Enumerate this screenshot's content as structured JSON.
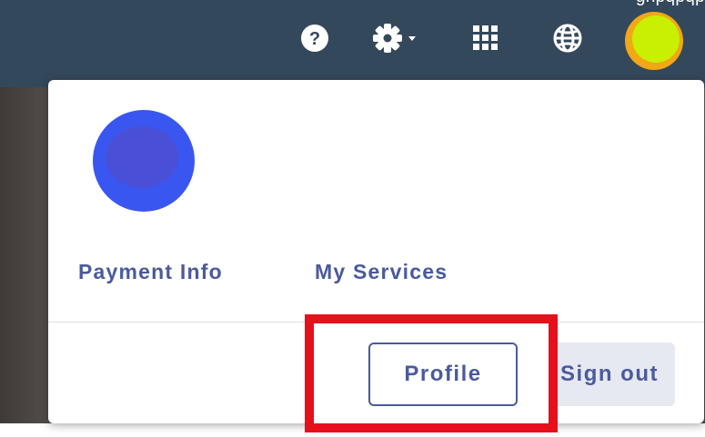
{
  "header": {
    "partial_text": "gnpqpqp",
    "icons": [
      "help-icon",
      "gear-icon",
      "chevron-down-icon",
      "apps-grid-icon",
      "globe-icon",
      "user-avatar"
    ],
    "colors": {
      "bar": "#34485c",
      "avatar_fill": "#c8f000",
      "avatar_ring": "#f2a716"
    }
  },
  "account_menu": {
    "avatar_color": "#3a56f0",
    "links": {
      "payment_info": "Payment Info",
      "my_services": "My Services"
    },
    "buttons": {
      "profile": "Profile",
      "sign_out": "Sign out"
    },
    "highlight_color": "#e5101b",
    "accent_color": "#4a5a9c"
  }
}
